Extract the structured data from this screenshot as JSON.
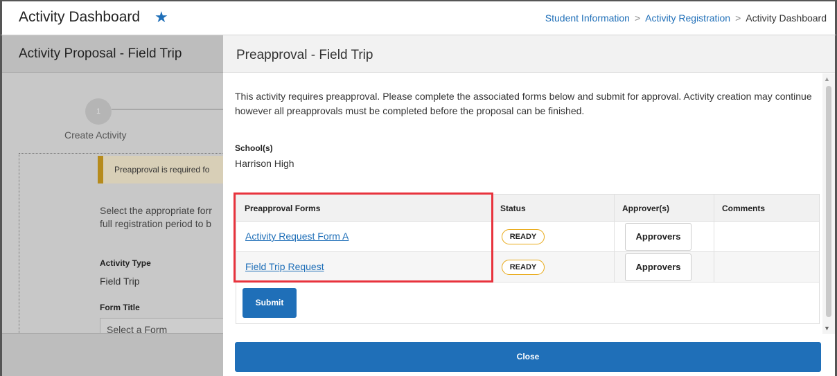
{
  "header": {
    "title": "Activity Dashboard",
    "star_icon": "star-icon",
    "breadcrumbs": [
      "Student Information",
      "Activity Registration",
      "Activity Dashboard"
    ],
    "separator": ">"
  },
  "left_panel": {
    "title": "Activity Proposal - Field Trip",
    "step_number": "1",
    "step_label": "Create Activity",
    "warning_text": "Preapproval is required fo",
    "description_line1": "Select the appropriate forr",
    "description_line2": "full registration period to b",
    "activity_type_label": "Activity Type",
    "activity_type_value": "Field Trip",
    "form_title_label": "Form Title",
    "form_select_placeholder": "Select a Form"
  },
  "modal": {
    "title": "Preapproval - Field Trip",
    "intro": "This activity requires preapproval. Please complete the associated forms below and submit for approval. Activity creation may continue however all preapprovals must be completed before the proposal can be finished.",
    "school_label": "School(s)",
    "school_value": "Harrison High",
    "table": {
      "headers": [
        "Preapproval Forms",
        "Status",
        "Approver(s)",
        "Comments"
      ],
      "rows": [
        {
          "form": "Activity Request Form A",
          "status": "READY",
          "approvers": "Approvers",
          "comments": ""
        },
        {
          "form": "Field Trip Request",
          "status": "READY",
          "approvers": "Approvers",
          "comments": ""
        }
      ]
    },
    "submit_label": "Submit",
    "close_label": "Close"
  },
  "colors": {
    "accent": "#1f6fb8",
    "highlight": "#e8333d",
    "badge_border": "#e8a813"
  }
}
